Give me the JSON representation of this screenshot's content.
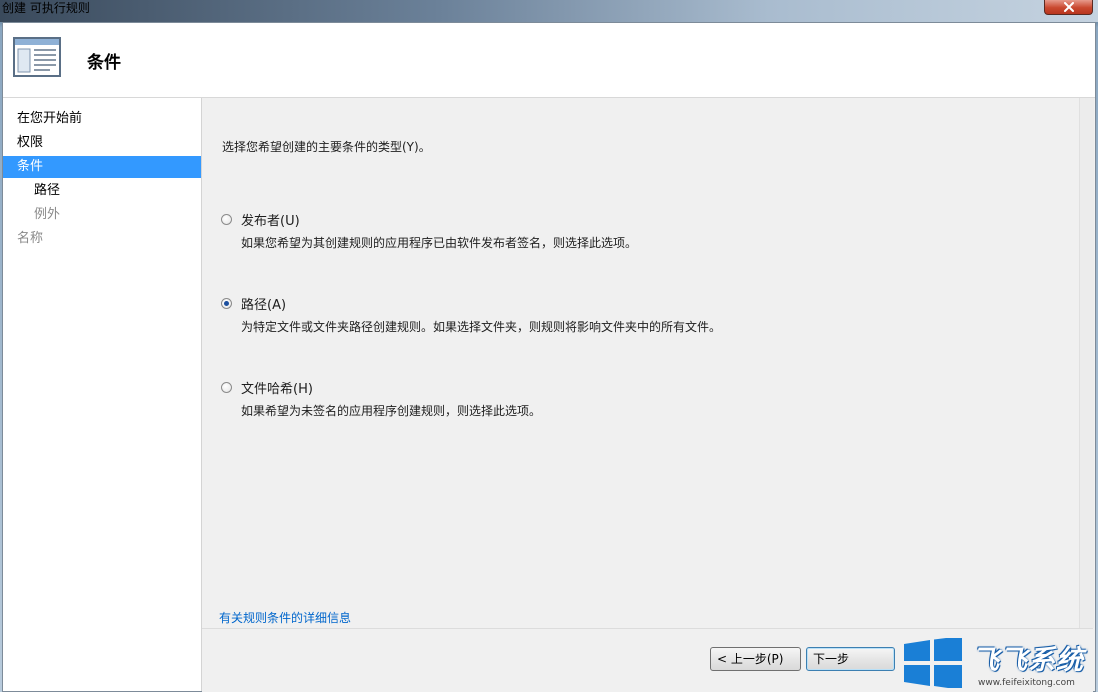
{
  "window": {
    "title": "创建 可执行规则"
  },
  "header": {
    "title": "条件"
  },
  "sidebar": {
    "items": [
      {
        "label": "在您开始前",
        "state": "normal"
      },
      {
        "label": "权限",
        "state": "normal"
      },
      {
        "label": "条件",
        "state": "selected"
      },
      {
        "label": "路径",
        "state": "sub"
      },
      {
        "label": "例外",
        "state": "sub-disabled"
      },
      {
        "label": "名称",
        "state": "disabled"
      }
    ]
  },
  "main": {
    "prompt": "选择您希望创建的主要条件的类型(Y)。",
    "options": [
      {
        "label": "发布者(U)",
        "checked": false,
        "description": "如果您希望为其创建规则的应用程序已由软件发布者签名，则选择此选项。"
      },
      {
        "label": "路径(A)",
        "checked": true,
        "description": "为特定文件或文件夹路径创建规则。如果选择文件夹，则规则将影响文件夹中的所有文件。"
      },
      {
        "label": "文件哈希(H)",
        "checked": false,
        "description": "如果希望为未签名的应用程序创建规则，则选择此选项。"
      }
    ],
    "help_link": "有关规则条件的详细信息"
  },
  "footer": {
    "prev_label": "< 上一步(P)",
    "next_label": "下一步"
  },
  "watermark": {
    "text": "飞飞系统",
    "url": "www.feifeixitong.com"
  },
  "colors": {
    "selection": "#3399ff",
    "link": "#0066cc",
    "close_button": "#c9482f",
    "watermark_blue": "#1a7fd6"
  }
}
